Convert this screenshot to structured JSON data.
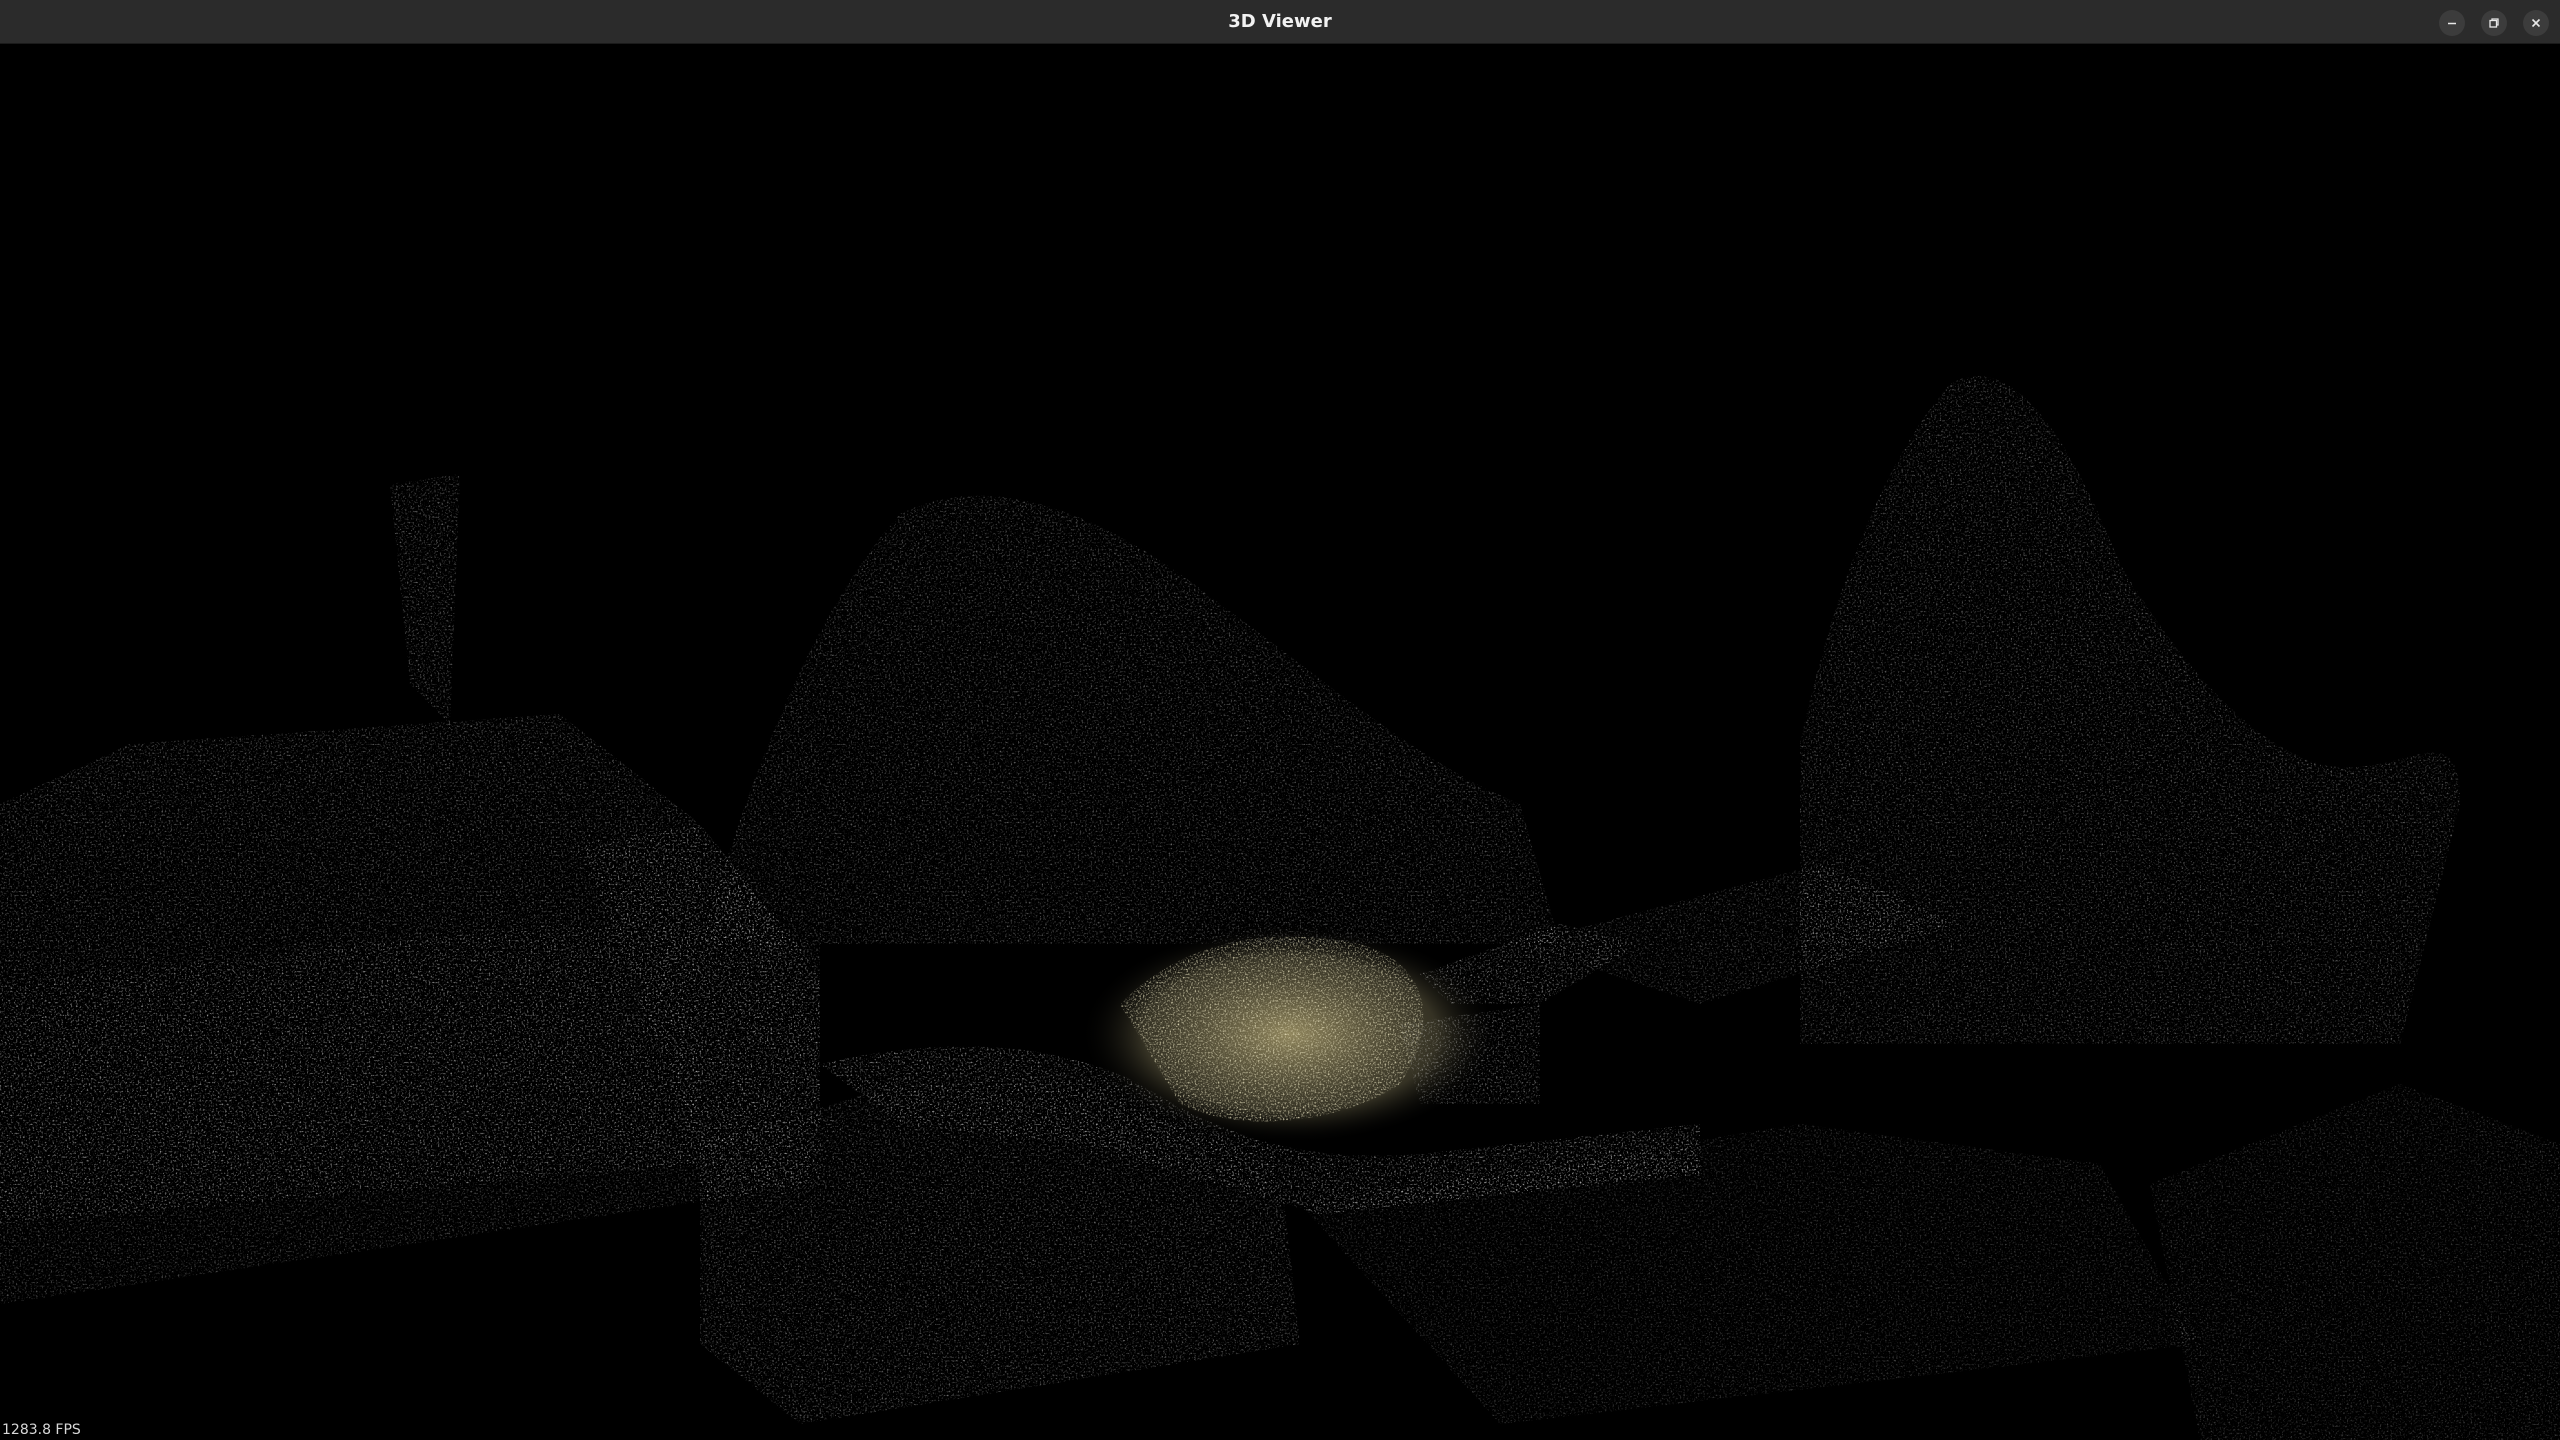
{
  "window": {
    "title": "3D Viewer",
    "controls": {
      "minimize_icon": "minimize-icon",
      "maximize_icon": "restore-icon",
      "close_icon": "close-icon"
    }
  },
  "viewport": {
    "content": "point-cloud",
    "fps_label": "1283.8 FPS",
    "background": "#000000",
    "highlight_color": "#b8ac7a"
  }
}
